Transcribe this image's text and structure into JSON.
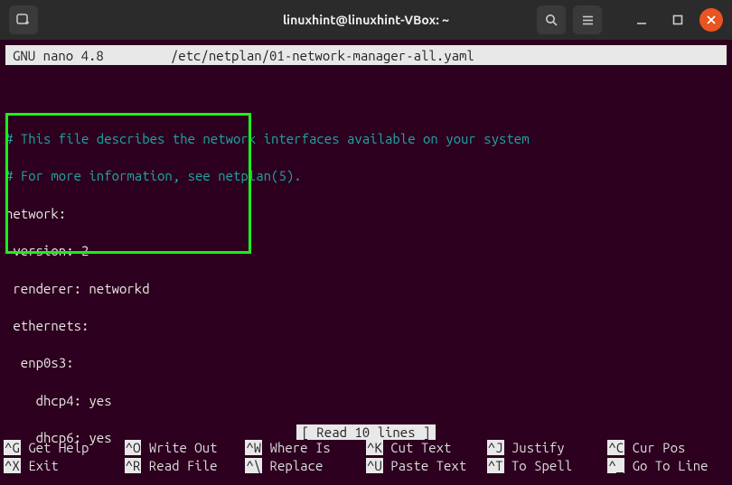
{
  "titlebar": {
    "title": "linuxhint@linuxhint-VBox: ~"
  },
  "nano": {
    "app": "GNU nano 4.8",
    "file": "/etc/netplan/01-network-manager-all.yaml",
    "status": "[ Read 10 lines ]"
  },
  "content": {
    "comment1": "# This file describes the network interfaces available on your system",
    "comment2": "# For more information, see netplan(5).",
    "yaml_lines": [
      "network:",
      " version: 2",
      " renderer: networkd",
      " ethernets:",
      "  enp0s3:",
      "    dhcp4: yes",
      "    dhcp6: yes"
    ]
  },
  "shortcuts": {
    "row1": [
      {
        "key": "^G",
        "label": "Get Help"
      },
      {
        "key": "^O",
        "label": "Write Out"
      },
      {
        "key": "^W",
        "label": "Where Is"
      },
      {
        "key": "^K",
        "label": "Cut Text"
      },
      {
        "key": "^J",
        "label": "Justify"
      },
      {
        "key": "^C",
        "label": "Cur Pos"
      }
    ],
    "row2": [
      {
        "key": "^X",
        "label": "Exit"
      },
      {
        "key": "^R",
        "label": "Read File"
      },
      {
        "key": "^\\",
        "label": "Replace"
      },
      {
        "key": "^U",
        "label": "Paste Text"
      },
      {
        "key": "^T",
        "label": "To Spell"
      },
      {
        "key": "^_",
        "label": "Go To Line"
      }
    ]
  }
}
